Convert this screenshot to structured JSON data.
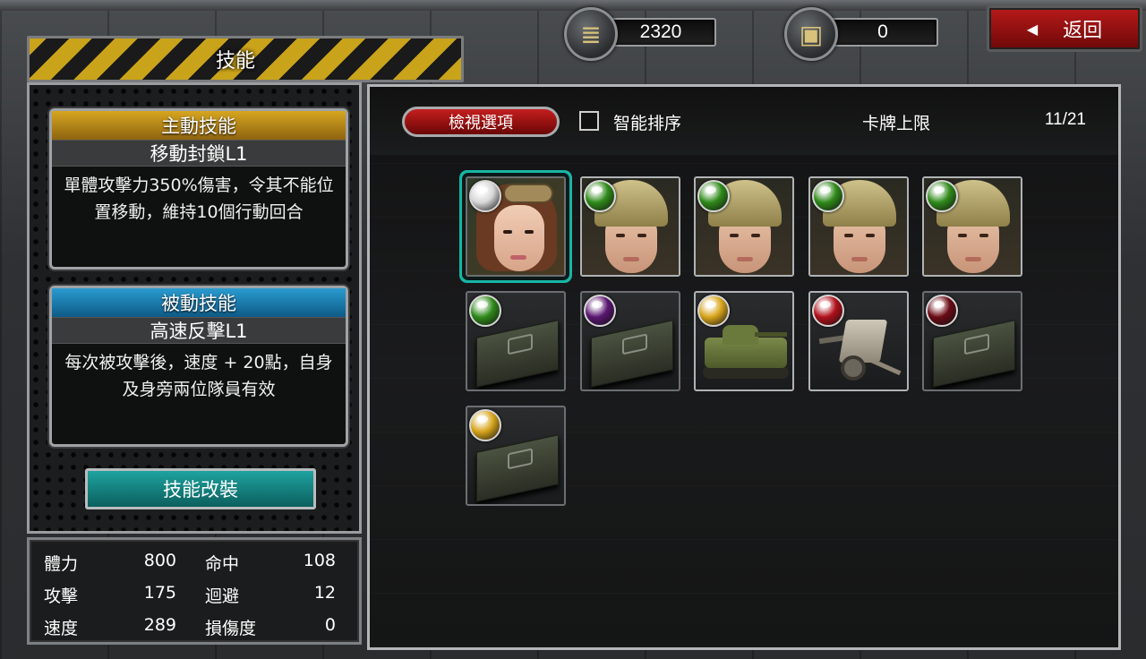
{
  "header": {
    "title": "技能",
    "currency": {
      "icon": "money-stack-icon",
      "value": "2320"
    },
    "crates": {
      "icon": "treasure-chest-icon",
      "value": "0"
    },
    "back_label": "返回"
  },
  "active_skill": {
    "header": "主動技能",
    "name": "移動封鎖L1",
    "description": "單體攻擊力350%傷害，令其不能位置移動，維持10個行動回合",
    "header_color": "#c89a1c"
  },
  "passive_skill": {
    "header": "被動技能",
    "name": "高速反擊L1",
    "description": "每次被攻擊後，速度 + 20點，自身及身旁兩位隊員有效",
    "header_color": "#1f86bc"
  },
  "modify_button": "技能改裝",
  "stats": [
    {
      "label1": "體力",
      "value1": "800",
      "label2": "命中",
      "value2": "108"
    },
    {
      "label1": "攻擊",
      "value1": "175",
      "label2": "迴避",
      "value2": "12"
    },
    {
      "label1": "速度",
      "value1": "289",
      "label2": "損傷度",
      "value2": "0"
    }
  ],
  "toolbar": {
    "view_options": "檢視選項",
    "smart_sort": "智能排序",
    "smart_sort_checked": false,
    "card_limit_label": "卡牌上限",
    "card_limit_value": "11/21"
  },
  "cards": [
    {
      "kind": "pilot-girl",
      "gem": "white",
      "selected": true
    },
    {
      "kind": "helmet-girl",
      "gem": "green"
    },
    {
      "kind": "helmet-girl",
      "gem": "green"
    },
    {
      "kind": "helmet-girl",
      "gem": "green"
    },
    {
      "kind": "helmet-girl",
      "gem": "green"
    },
    {
      "kind": "ammo-crate",
      "gem": "green"
    },
    {
      "kind": "ammo-crate",
      "gem": "purple"
    },
    {
      "kind": "camo-tank",
      "gem": "gold"
    },
    {
      "kind": "field-gun",
      "gem": "red"
    },
    {
      "kind": "ammo-crate",
      "gem": "dark-red"
    },
    {
      "kind": "ammo-crate",
      "gem": "gold"
    }
  ],
  "gem_colors": {
    "white": "#d8d8d8",
    "green": "#2f8a1a",
    "purple": "#5a1670",
    "gold": "#d7a41a",
    "red": "#b0101a",
    "dark-red": "#6a0a14"
  },
  "colors": {
    "accent_teal": "#17b6a4",
    "button_red": "#b81a1a"
  }
}
